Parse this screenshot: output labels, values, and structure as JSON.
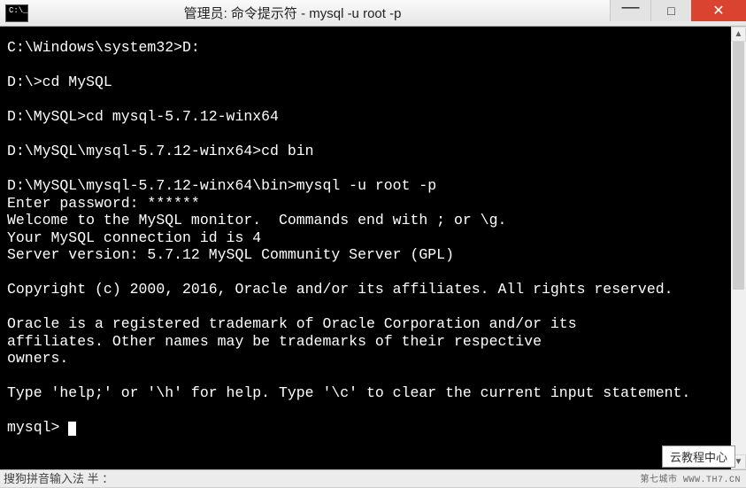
{
  "window": {
    "icon_text": "C:\\_",
    "title": "管理员: 命令提示符 - mysql  -u root -p",
    "controls": {
      "min": "—",
      "max": "□",
      "close": "✕"
    }
  },
  "terminal": {
    "lines": [
      "C:\\Windows\\system32>D:",
      "",
      "D:\\>cd MySQL",
      "",
      "D:\\MySQL>cd mysql-5.7.12-winx64",
      "",
      "D:\\MySQL\\mysql-5.7.12-winx64>cd bin",
      "",
      "D:\\MySQL\\mysql-5.7.12-winx64\\bin>mysql -u root -p",
      "Enter password: ******",
      "Welcome to the MySQL monitor.  Commands end with ; or \\g.",
      "Your MySQL connection id is 4",
      "Server version: 5.7.12 MySQL Community Server (GPL)",
      "",
      "Copyright (c) 2000, 2016, Oracle and/or its affiliates. All rights reserved.",
      "",
      "Oracle is a registered trademark of Oracle Corporation and/or its",
      "affiliates. Other names may be trademarks of their respective",
      "owners.",
      "",
      "Type 'help;' or '\\h' for help. Type '\\c' to clear the current input statement.",
      ""
    ],
    "prompt": "mysql> "
  },
  "scrollbar": {
    "up": "▲",
    "down": "▼"
  },
  "ime": {
    "text": "搜狗拼音输入法 半 ："
  },
  "badge": {
    "text": "云教程中心"
  },
  "footer": {
    "text": "第七城市   WWW.TH7.CN"
  }
}
